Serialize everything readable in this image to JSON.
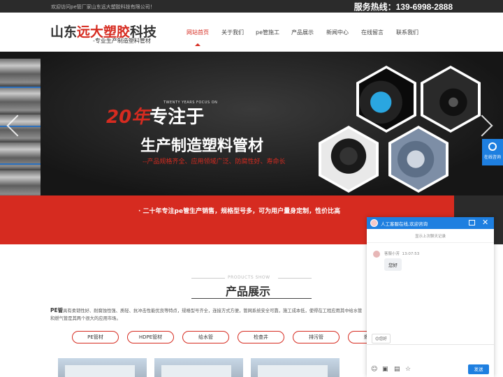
{
  "topbar": {
    "welcome": "欢迎访问pe管厂家山东远大塑胶科技有限公司！",
    "hotline": "服务热线：139-6998-2888"
  },
  "logo": {
    "part1": "山东",
    "part2": "远大塑胶",
    "part3": "科技",
    "subtitle": "-专业生产制造塑料管材"
  },
  "nav": [
    "网站首页",
    "关于我们",
    "pe管施工",
    "产品展示",
    "新闻中心",
    "在线留言",
    "联系我们"
  ],
  "banner": {
    "small": "TWENTY YEARS FOCUS ON",
    "big_red": "20年",
    "big_white": "专注于",
    "line2": "生产制造塑料管材",
    "line3": "--产品规格齐全、应用领域广泛、防腐性好、寿命长",
    "band": "·  二十年专注pe管生产销售，规格型号多，可为用户量身定制，性价比高"
  },
  "side_consult": "在线咨询",
  "products": {
    "en": "PRODUCTS SHOW",
    "cn": "产品展示",
    "lead": "PE管",
    "desc": "具有柔韧性好、耐腐蚀性强、质轻、抗冲击性能优良等特点，规格型号齐全，连接方式方便，管网系统安全可靠，施工成本低，使得在工程应用其中给水管和燃气管是其两个很大的应用市场。",
    "categories": [
      "PE管材",
      "HDPE管材",
      "给水管",
      "检查井",
      "排污管",
      "燃气管"
    ]
  },
  "chat": {
    "title": "人工客服在线,欢迎咨询",
    "history": "显示上次聊天记录",
    "agent": "客服小芳",
    "time": "13:07:53",
    "message": "您好",
    "quick": "😊您好",
    "send": "发送"
  },
  "colors": {
    "brand_red": "#d62b20",
    "chat_blue": "#1e7fe0"
  }
}
